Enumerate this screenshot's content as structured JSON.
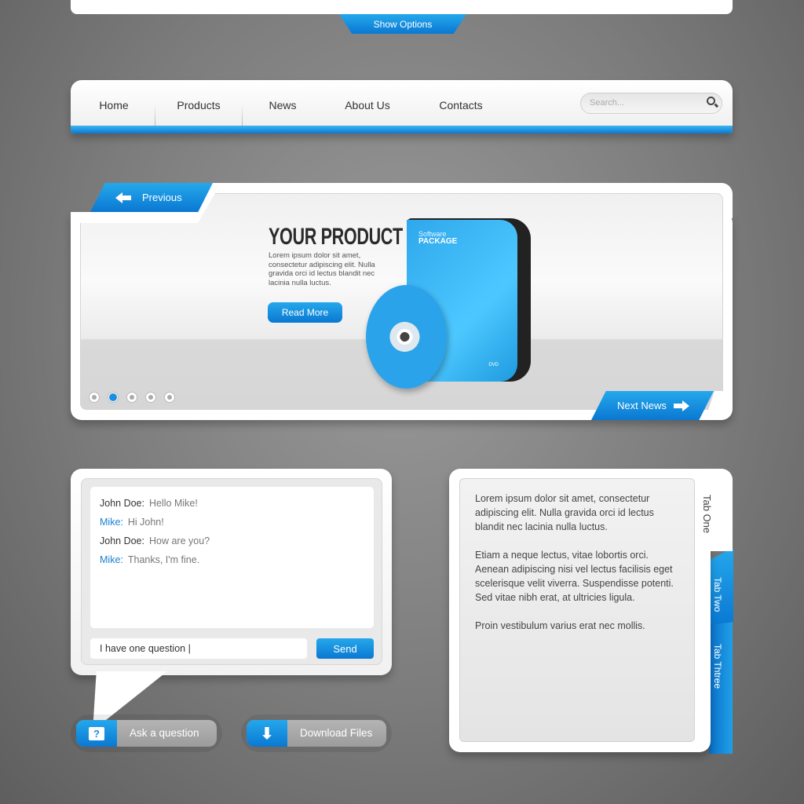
{
  "top": {
    "show_options": "Show Options"
  },
  "nav": {
    "items": [
      "Home",
      "Products",
      "News",
      "About Us",
      "Contacts"
    ],
    "search_placeholder": "Search..."
  },
  "slider": {
    "previous": "Previous",
    "next": "Next News",
    "title": "YOUR PRODUCT",
    "description": "Lorem ipsum dolor sit amet, consectetur adipiscing elit. Nulla gravida orci id lectus blandit nec lacinia nulla luctus.",
    "read_more": "Read More",
    "package_line1": "Software",
    "package_line2": "PACKAGE",
    "package_badge": "DVD",
    "dots_total": 5,
    "active_dot": 2
  },
  "chat": {
    "messages": [
      {
        "who": "John Doe:",
        "text": "Hello Mike!"
      },
      {
        "who": "Mike:",
        "text": "Hi John!"
      },
      {
        "who": "John Doe:",
        "text": "How are you?"
      },
      {
        "who": "Mike:",
        "text": "Thanks, I'm fine."
      }
    ],
    "input_value": "I have one question |",
    "send": "Send"
  },
  "buttons": {
    "ask": "Ask a question",
    "download": "Download Files"
  },
  "tabs": {
    "labels": [
      "Tab One",
      "Tab Two",
      "Tab Thtree"
    ],
    "active": "Tab One",
    "paragraphs": [
      "Lorem ipsum dolor sit amet, consectetur adipiscing elit. Nulla gravida orci id lectus blandit nec lacinia nulla luctus.",
      "Etiam a neque lectus, vitae lobortis orci. Aenean adipiscing nisi vel lectus facilisis eget scelerisque velit viverra. Suspendisse potenti. Sed vitae nibh erat, at ultricies ligula.",
      "Proin vestibulum varius erat nec mollis."
    ]
  },
  "colors": {
    "accent": "#1a8ee0",
    "background": "#7c7c7c"
  }
}
